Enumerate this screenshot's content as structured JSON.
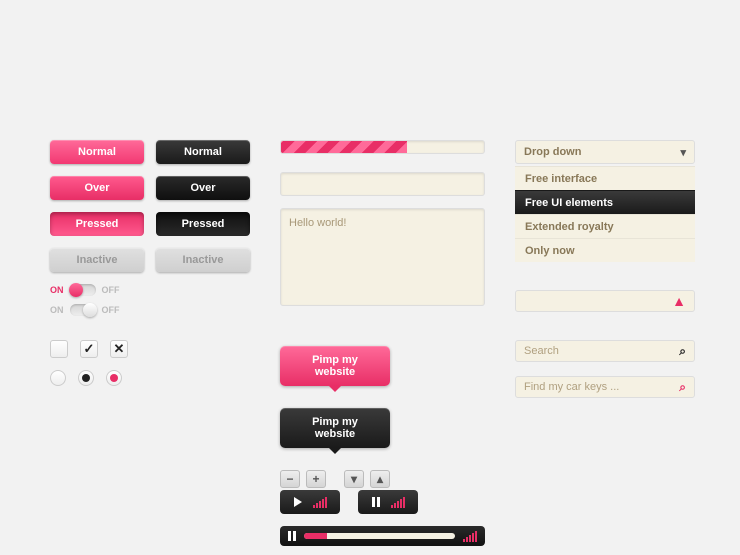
{
  "buttons": {
    "pink": {
      "normal": "Normal",
      "over": "Over",
      "pressed": "Pressed",
      "inactive": "Inactive"
    },
    "dark": {
      "normal": "Normal",
      "over": "Over",
      "pressed": "Pressed",
      "inactive": "Inactive"
    }
  },
  "toggle": {
    "on": "ON",
    "off": "OFF"
  },
  "tooltip": {
    "pink": "Pimp my website",
    "dark": "Pimp my website"
  },
  "textarea": {
    "value": "Hello world!"
  },
  "dropdown": {
    "label": "Drop down"
  },
  "menu": {
    "items": [
      {
        "label": "Free interface",
        "selected": false
      },
      {
        "label": "Free UI elements",
        "selected": true
      },
      {
        "label": "Extended royalty",
        "selected": false
      },
      {
        "label": "Only now",
        "selected": false
      }
    ]
  },
  "search": {
    "placeholder1": "Search",
    "placeholder2": "Find my car keys ..."
  },
  "progress": {
    "percent": 62
  },
  "player": {
    "progress_percent": 15
  },
  "colors": {
    "pink": "#e82e66",
    "cream": "#f5f1e3",
    "dark": "#1a1a1a"
  }
}
